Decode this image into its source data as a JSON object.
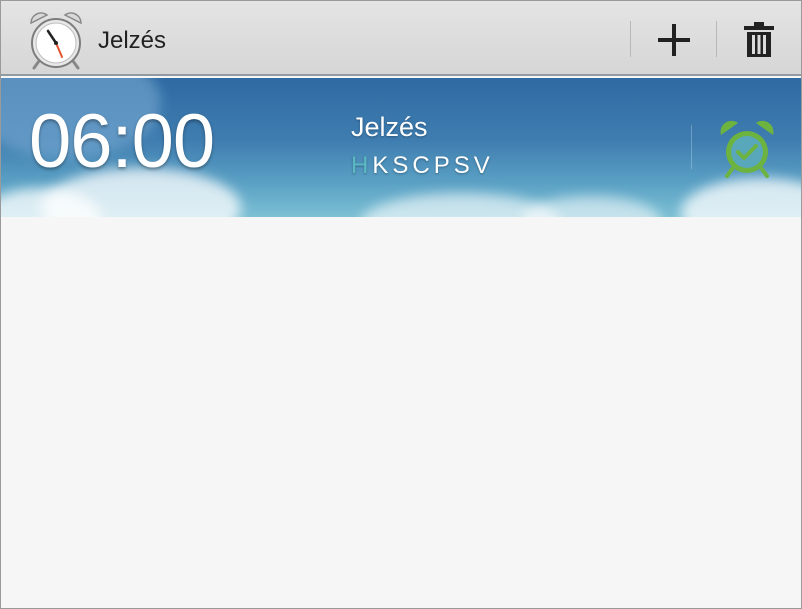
{
  "header": {
    "title": "Jelzés",
    "app_icon": "alarm-clock-icon",
    "actions": [
      {
        "name": "add",
        "icon": "plus-icon"
      },
      {
        "name": "delete",
        "icon": "trash-icon"
      }
    ]
  },
  "alarms": [
    {
      "time": "06:00",
      "name": "Jelzés",
      "days": [
        "H",
        "K",
        "S",
        "C",
        "P",
        "S",
        "V"
      ],
      "active_day_index": 0,
      "enabled": true,
      "toggle_icon": "alarm-on-icon"
    }
  ],
  "colors": {
    "active_day": "#59b8c2",
    "alarm_on_green": "#6db33f",
    "row_blue": "#3f7db0"
  }
}
